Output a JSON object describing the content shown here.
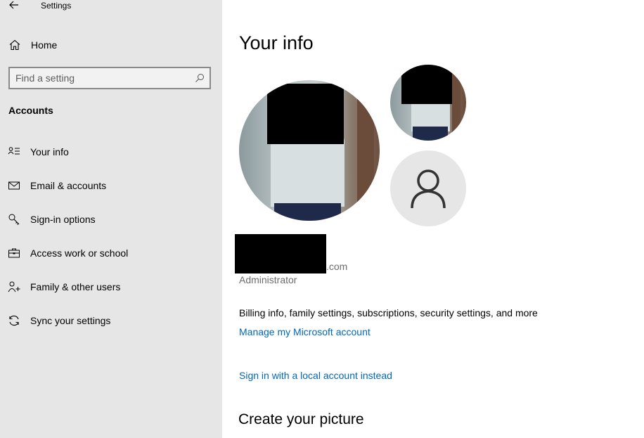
{
  "window": {
    "title": "Settings"
  },
  "sidebar": {
    "home_label": "Home",
    "search_placeholder": "Find a setting",
    "section_title": "Accounts",
    "items": [
      {
        "label": "Your info",
        "icon": "contact-info-icon"
      },
      {
        "label": "Email & accounts",
        "icon": "mail-icon"
      },
      {
        "label": "Sign-in options",
        "icon": "key-icon"
      },
      {
        "label": "Access work or school",
        "icon": "briefcase-icon"
      },
      {
        "label": "Family & other users",
        "icon": "add-person-icon"
      },
      {
        "label": "Sync your settings",
        "icon": "sync-icon"
      }
    ]
  },
  "main": {
    "title": "Your info",
    "email_suffix": ".com",
    "role": "Administrator",
    "billing_text": "Billing info, family settings, subscriptions, security settings, and more",
    "manage_link": "Manage my Microsoft account",
    "local_account_link": "Sign in with a local account instead",
    "create_picture_heading": "Create your picture"
  },
  "colors": {
    "sidebar_bg": "#e6e6e6",
    "link": "#0067b8",
    "secondary_text": "#6b6b6b"
  }
}
